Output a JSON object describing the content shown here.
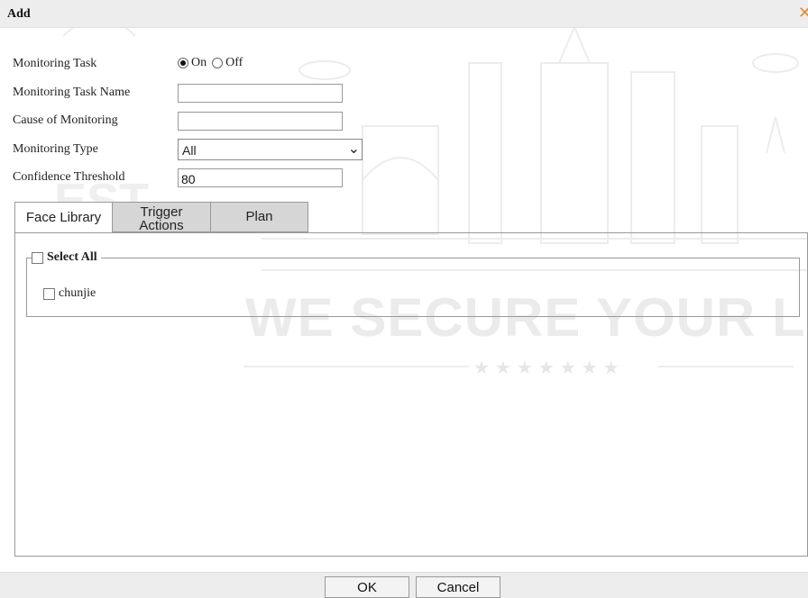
{
  "dialog": {
    "title": "Add"
  },
  "form": {
    "monitoring_task_label": "Monitoring Task",
    "radio_on": "On",
    "radio_off": "Off",
    "selected": "On",
    "task_name_label": "Monitoring Task Name",
    "task_name_value": "",
    "cause_label": "Cause of Monitoring",
    "cause_value": "",
    "type_label": "Monitoring Type",
    "type_value": "All",
    "threshold_label": "Confidence Threshold",
    "threshold_value": "80"
  },
  "tabs": [
    {
      "label": "Face Library",
      "active": true
    },
    {
      "label_line1": "Trigger",
      "label_line2": "Actions",
      "active": false
    },
    {
      "label": "Plan",
      "active": false
    }
  ],
  "library": {
    "select_all_label": "Select All",
    "items": [
      {
        "label": "chunjie",
        "checked": false
      }
    ]
  },
  "footer": {
    "ok_label": "OK",
    "cancel_label": "Cancel"
  },
  "watermark": {
    "line1": "WE SECURE YOUR L",
    "badge": "EST.",
    "stars": "★★★★★★★"
  },
  "colors": {
    "close_icon": "#e88a2a",
    "tab_inactive": "#d6d6d6"
  }
}
